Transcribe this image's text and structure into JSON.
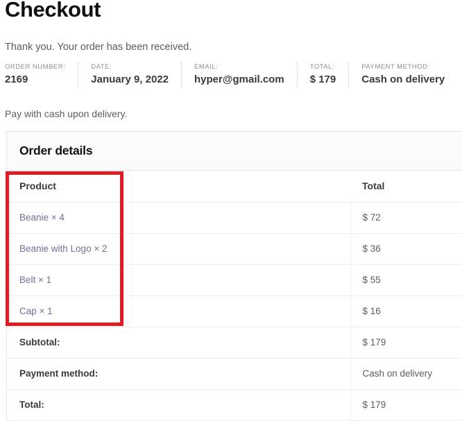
{
  "page": {
    "title": "Checkout",
    "thank_you": "Thank you. Your order has been received.",
    "payment_note": "Pay with cash upon delivery."
  },
  "order_summary": [
    {
      "label": "ORDER NUMBER:",
      "value": "2169"
    },
    {
      "label": "DATE:",
      "value": "January 9, 2022"
    },
    {
      "label": "EMAIL:",
      "value": "hyper@gmail.com"
    },
    {
      "label": "TOTAL:",
      "value": "$ 179"
    },
    {
      "label": "PAYMENT METHOD:",
      "value": "Cash on delivery"
    }
  ],
  "order_details": {
    "heading": "Order details",
    "columns": {
      "product": "Product",
      "total": "Total"
    },
    "items": [
      {
        "product": "Beanie × 4",
        "total": "$ 72"
      },
      {
        "product": "Beanie with Logo × 2",
        "total": "$ 36"
      },
      {
        "product": "Belt × 1",
        "total": "$ 55"
      },
      {
        "product": "Cap × 1",
        "total": "$ 16"
      }
    ],
    "footer": [
      {
        "label": "Subtotal:",
        "value": "$ 179"
      },
      {
        "label": "Payment method:",
        "value": "Cash on delivery"
      },
      {
        "label": "Total:",
        "value": "$ 179"
      }
    ]
  },
  "annotation": {
    "color": "#e01b22"
  }
}
